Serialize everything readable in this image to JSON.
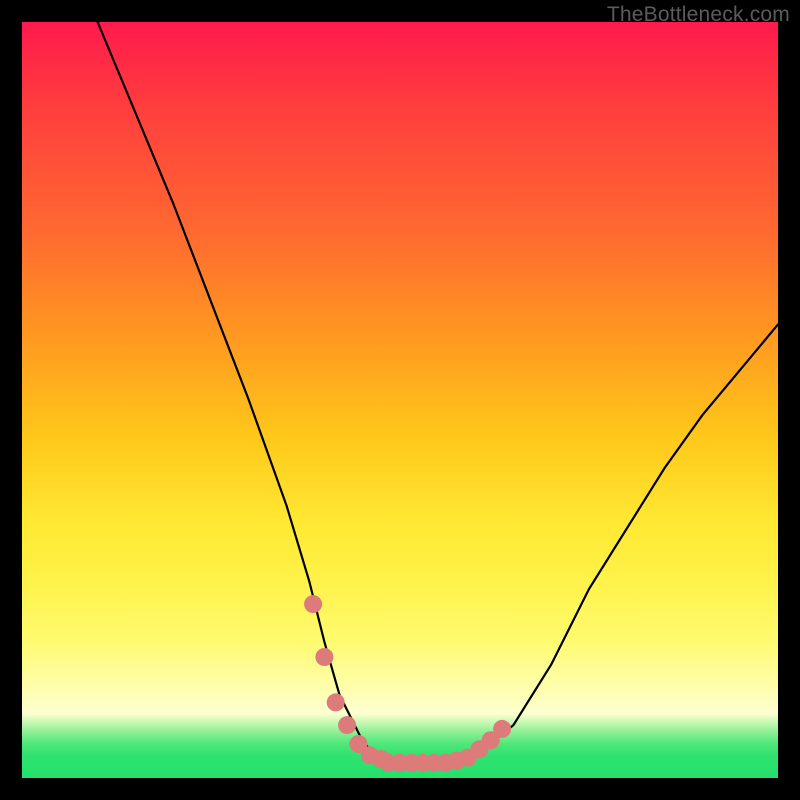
{
  "watermark": {
    "text": "TheBottleneck.com"
  },
  "chart_data": {
    "type": "line",
    "title": "",
    "xlabel": "",
    "ylabel": "",
    "xlim": [
      0,
      100
    ],
    "ylim": [
      0,
      100
    ],
    "grid": false,
    "series": [
      {
        "name": "curve",
        "x": [
          10,
          15,
          20,
          25,
          30,
          35,
          38,
          40,
          42,
          45,
          47,
          50,
          55,
          60,
          65,
          70,
          75,
          80,
          85,
          90,
          95,
          100
        ],
        "y": [
          100,
          88,
          76,
          63,
          50,
          36,
          26,
          18,
          11,
          5,
          2.5,
          2,
          2,
          3,
          7,
          15,
          25,
          33,
          41,
          48,
          54,
          60
        ]
      }
    ],
    "marker_groups": [
      {
        "name": "left-cluster",
        "color": "#dd7a7a",
        "x": [
          38.5,
          40,
          41.5,
          43,
          44.5,
          46,
          47.5
        ],
        "y": [
          23,
          16,
          10,
          7,
          4.5,
          3,
          2.5
        ]
      },
      {
        "name": "bottom-bar",
        "color": "#dd7a7a",
        "x": [
          48.5,
          50,
          51.5,
          53,
          54.5,
          56,
          57.5,
          59
        ],
        "y": [
          2,
          2,
          2,
          2,
          2,
          2,
          2.3,
          2.7
        ]
      },
      {
        "name": "right-cluster",
        "color": "#dd7a7a",
        "x": [
          60.5,
          62,
          63.5
        ],
        "y": [
          3.8,
          5,
          6.5
        ]
      }
    ],
    "colors": {
      "curve": "#000000",
      "marker": "#dd7a7a",
      "gradient_top": "#ff1a4d",
      "gradient_bottom": "#24e06b"
    }
  }
}
